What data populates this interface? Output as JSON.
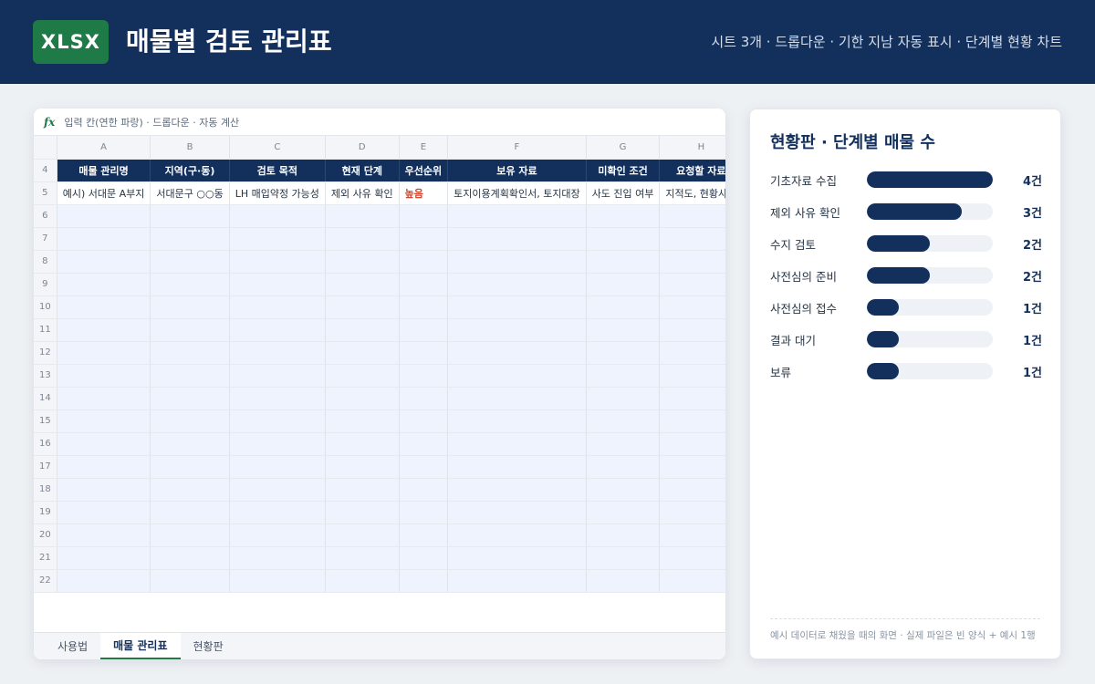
{
  "header": {
    "badge": "XLSX",
    "title": "매물별 검토 관리표",
    "subtitle": "시트 3개 · 드롭다운 · 기한 지남 자동 표시 · 단계별 현황 차트"
  },
  "formula_bar": {
    "icon": "fx",
    "text": "입력 칸(연한 파랑) · 드롭다운 · 자동 계산"
  },
  "sheet": {
    "column_letters": [
      "A",
      "B",
      "C",
      "D",
      "E",
      "F",
      "G",
      "H"
    ],
    "header_row_number": "4",
    "headers": [
      "매물 관리명",
      "지역(구·동)",
      "검토 목적",
      "현재 단계",
      "우선순위",
      "보유 자료",
      "미확인 조건",
      "요청할 자료"
    ],
    "example_row_number": "5",
    "example_row": [
      "예시) 서대문 A부지",
      "서대문구 ○○동",
      "LH 매입약정 가능성",
      "제외 사유 확인",
      "높음",
      "토지이용계획확인서, 토지대장",
      "사도 진입 여부",
      "지적도, 현황사진"
    ],
    "empty_row_numbers": [
      "6",
      "7",
      "8",
      "9",
      "10",
      "11",
      "12",
      "13",
      "14",
      "15",
      "16",
      "17",
      "18",
      "19",
      "20",
      "21",
      "22"
    ]
  },
  "tabs": [
    {
      "label": "사용법",
      "active": false
    },
    {
      "label": "매물 관리표",
      "active": true
    },
    {
      "label": "현황판",
      "active": false
    }
  ],
  "dashboard": {
    "title": "현황판 · 단계별 매물 수",
    "max": 4,
    "items": [
      {
        "label": "기초자료 수집",
        "count": 4,
        "count_text": "4건"
      },
      {
        "label": "제외 사유 확인",
        "count": 3,
        "count_text": "3건"
      },
      {
        "label": "수지 검토",
        "count": 2,
        "count_text": "2건"
      },
      {
        "label": "사전심의 준비",
        "count": 2,
        "count_text": "2건"
      },
      {
        "label": "사전심의 접수",
        "count": 1,
        "count_text": "1건"
      },
      {
        "label": "결과 대기",
        "count": 1,
        "count_text": "1건"
      },
      {
        "label": "보류",
        "count": 1,
        "count_text": "1건"
      }
    ],
    "footnote": "예시 데이터로 채웠을 때의 화면 · 실제 파일은 빈 양식 + 예시 1행"
  },
  "colors": {
    "navy": "#13305c",
    "green": "#1e7a46",
    "input_fill": "#eef3fd",
    "priority_high": "#d1452c"
  }
}
